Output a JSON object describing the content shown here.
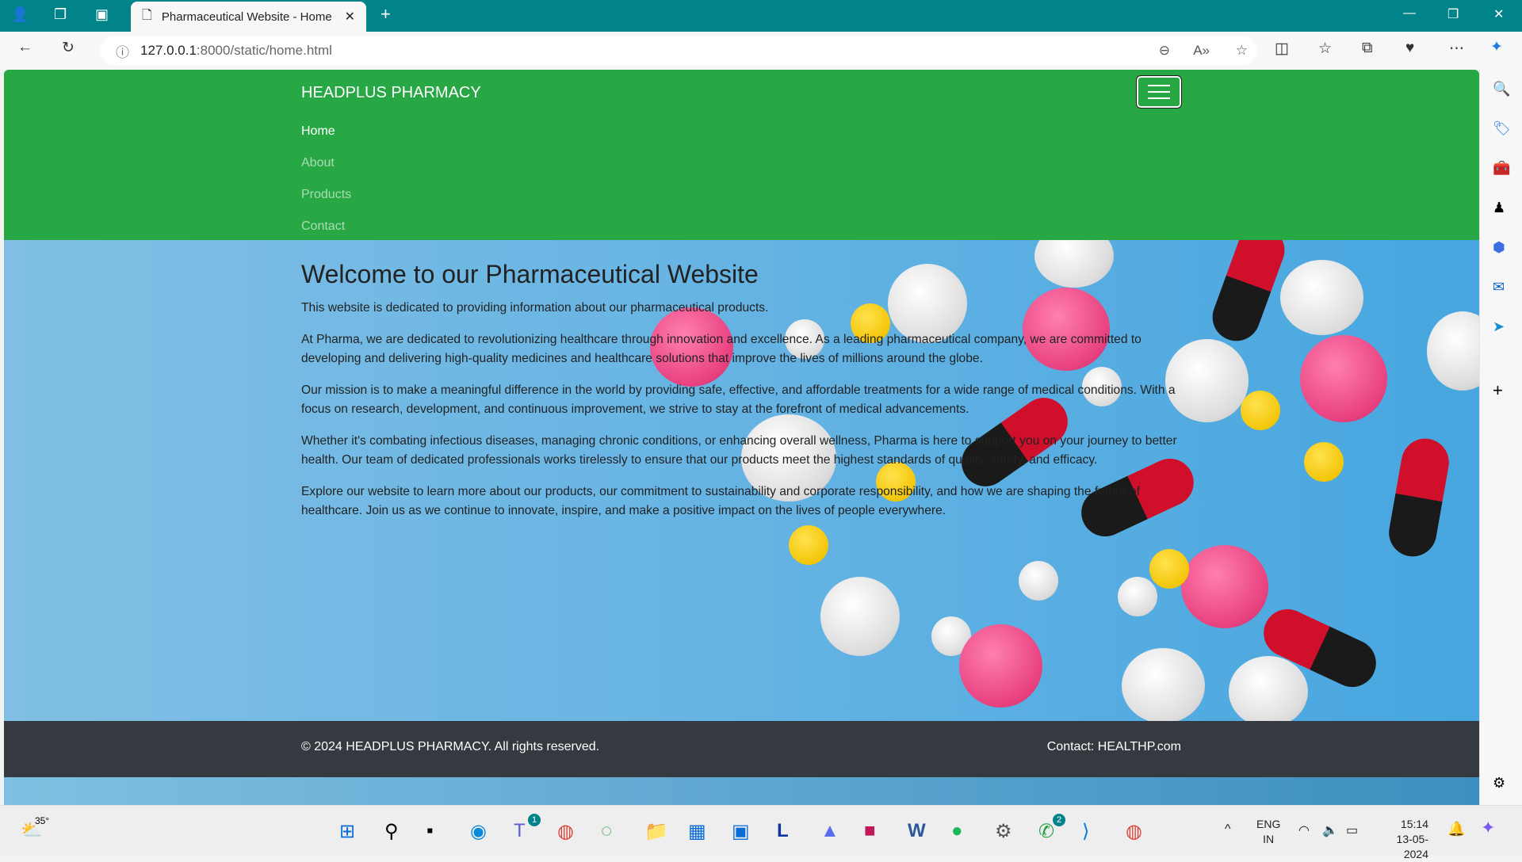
{
  "browser": {
    "tab_title": "Pharmaceutical Website - Home",
    "url_host": "127.0.0.1",
    "url_rest": ":8000/static/home.html"
  },
  "nav": {
    "brand": "HEADPLUS PHARMACY",
    "links": [
      {
        "label": "Home",
        "active": true
      },
      {
        "label": "About"
      },
      {
        "label": "Products"
      },
      {
        "label": "Contact"
      }
    ]
  },
  "main": {
    "title": "Welcome to our Pharmaceutical Website",
    "paragraphs": [
      "This website is dedicated to providing information about our pharmaceutical products.",
      "At Pharma, we are dedicated to revolutionizing healthcare through innovation and excellence. As a leading pharmaceutical company, we are committed to developing and delivering high-quality medicines and healthcare solutions that improve the lives of millions around the globe.",
      "Our mission is to make a meaningful difference in the world by providing safe, effective, and affordable treatments for a wide range of medical conditions. With a focus on research, development, and continuous improvement, we strive to stay at the forefront of medical advancements.",
      "Whether it's combating infectious diseases, managing chronic conditions, or enhancing overall wellness, Pharma is here to support you on your journey to better health. Our team of dedicated professionals works tirelessly to ensure that our products meet the highest standards of quality, safety, and efficacy.",
      "Explore our website to learn more about our products, our commitment to sustainability and corporate responsibility, and how we are shaping the future of healthcare. Join us as we continue to innovate, inspire, and make a positive impact on the lives of people everywhere."
    ]
  },
  "footer": {
    "copyright": "© 2024 HEADPLUS PHARMACY. All rights reserved.",
    "contact": "Contact: HEALTHP.com"
  },
  "taskbar": {
    "weather": "35°",
    "lang1": "ENG",
    "lang2": "IN",
    "time": "15:14",
    "date": "13-05-2024",
    "whatsapp_badge": "2",
    "teams_badge": "1"
  },
  "colors": {
    "navbar": "#28a745",
    "footer": "#343a40",
    "tabbar": "#00848a"
  }
}
